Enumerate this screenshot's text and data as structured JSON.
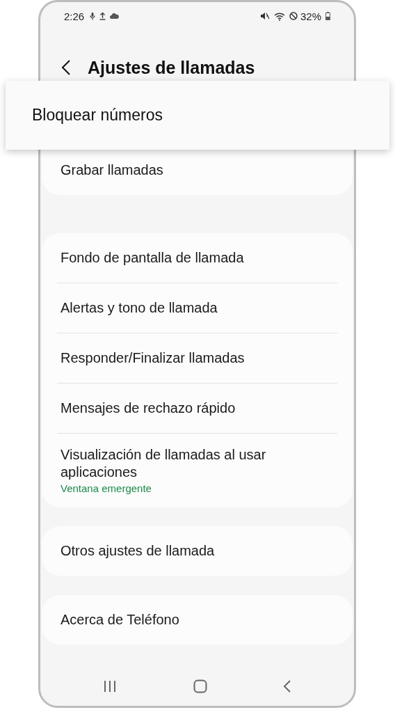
{
  "status_bar": {
    "time": "2:26",
    "battery": "32%"
  },
  "header": {
    "title": "Ajustes de llamadas"
  },
  "callout": {
    "label": "Bloquear números"
  },
  "groups": [
    {
      "items": [
        {
          "label": "Grabar llamadas"
        }
      ]
    },
    {
      "items": [
        {
          "label": "Fondo de pantalla de llamada"
        },
        {
          "label": "Alertas y tono de llamada"
        },
        {
          "label": "Responder/Finalizar llamadas"
        },
        {
          "label": "Mensajes de rechazo rápido"
        },
        {
          "label": "Visualización de llamadas al usar aplicaciones",
          "subtitle": "Ventana emergente"
        }
      ]
    },
    {
      "items": [
        {
          "label": "Otros ajustes de llamada"
        }
      ]
    },
    {
      "items": [
        {
          "label": "Acerca de Teléfono"
        }
      ]
    }
  ]
}
